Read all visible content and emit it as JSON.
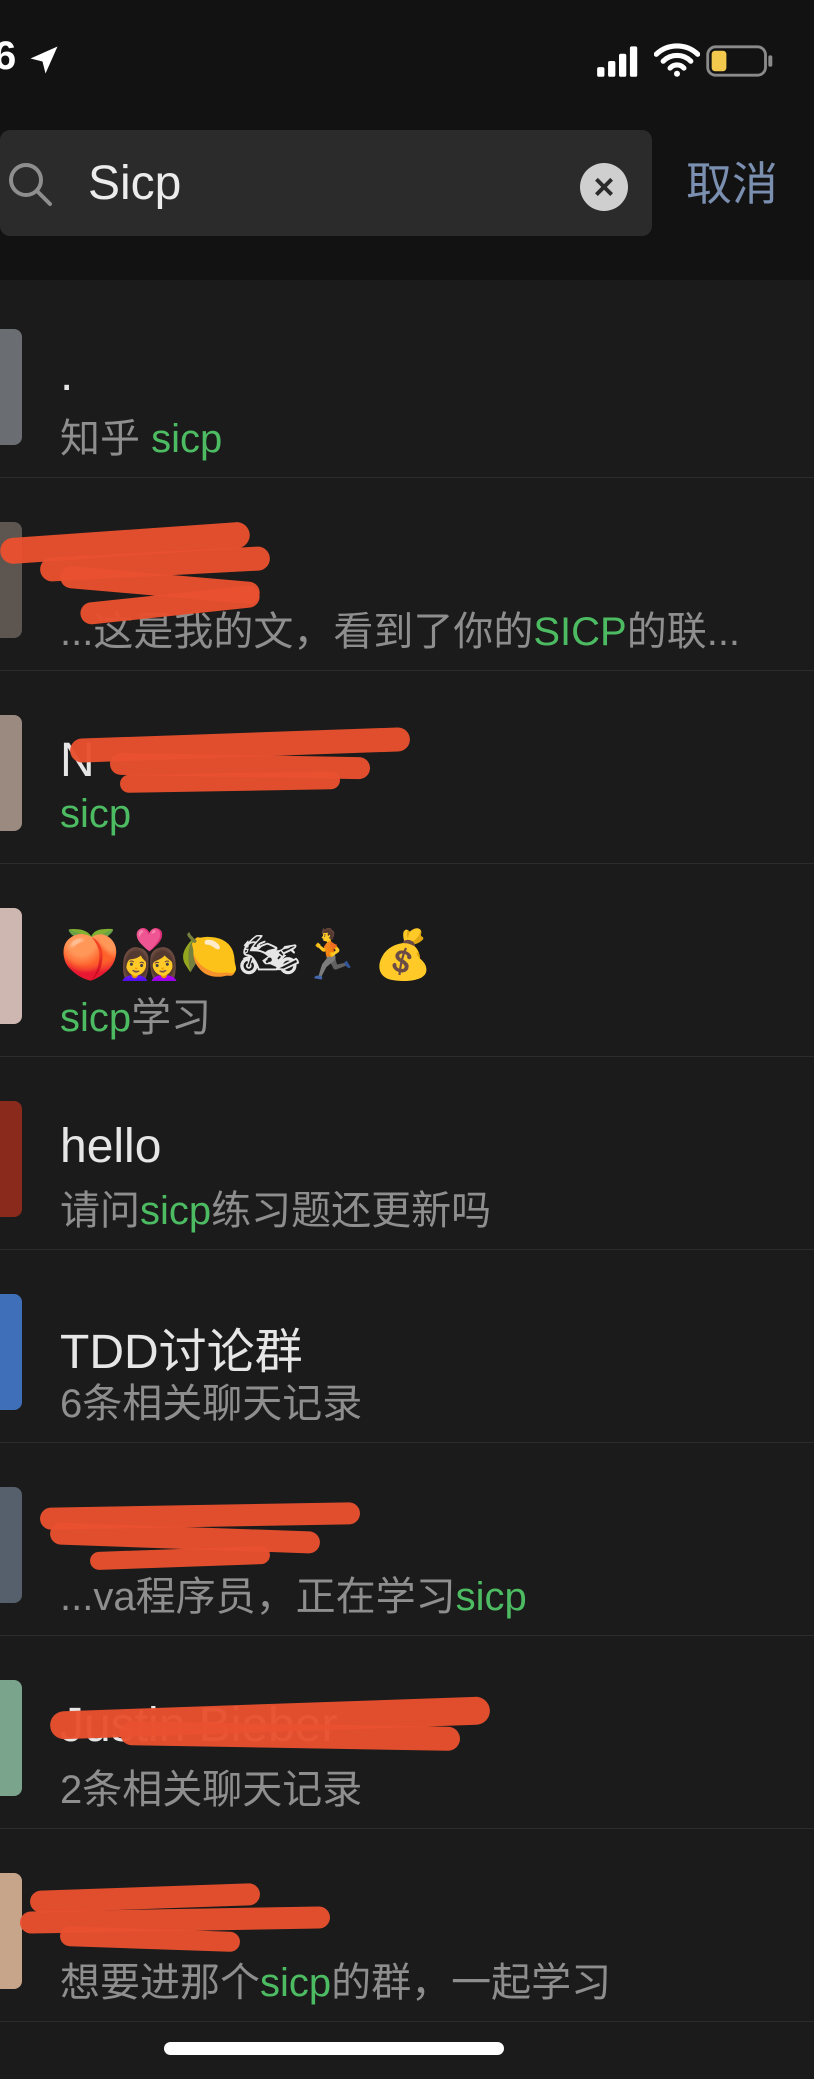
{
  "status_bar": {
    "time": "6",
    "icons": [
      "location-arrow-icon",
      "cellular-signal-icon",
      "wifi-icon",
      "battery-low-icon"
    ],
    "battery_color": "#f2c94c"
  },
  "search": {
    "query": "Sicp",
    "cancel_label": "取消",
    "clear_icon": "×"
  },
  "colors": {
    "background": "#1b1b1b",
    "header": "#121212",
    "highlight": "#4cbb62",
    "cancel": "#7b8fb0",
    "redaction": "#e8512f"
  },
  "results": [
    {
      "title": ".",
      "sub": [
        {
          "text": "知乎 "
        },
        {
          "text": "sicp",
          "hl": true
        }
      ],
      "avatar": "#6a6e73"
    },
    {
      "title": "",
      "redacted_title": true,
      "sub": [
        {
          "text": "...这是我的文，看到了你的"
        },
        {
          "text": "SICP",
          "hl": true
        },
        {
          "text": "的联..."
        }
      ],
      "avatar": "#5d5550"
    },
    {
      "title": "N",
      "redacted_title": true,
      "sub": [
        {
          "text": "sicp",
          "hl": true
        }
      ],
      "avatar": "#9a8a80"
    },
    {
      "title": "🍑👩‍❤️‍👩🍋🏍🏃 💰",
      "sub": [
        {
          "text": "sicp",
          "hl": true
        },
        {
          "text": "学习"
        }
      ],
      "avatar": "#cdb7b0"
    },
    {
      "title": "hello",
      "sub": [
        {
          "text": "请问"
        },
        {
          "text": "sicp",
          "hl": true
        },
        {
          "text": "练习题还更新吗"
        }
      ],
      "avatar": "#8a2a1c"
    },
    {
      "title": "TDD讨论群",
      "sub": [
        {
          "text": "6条相关聊天记录"
        }
      ],
      "avatar": "#3f6fb8"
    },
    {
      "title": "",
      "redacted_title": true,
      "sub": [
        {
          "text": "...va程序员，正在学习"
        },
        {
          "text": "sicp",
          "hl": true
        }
      ],
      "avatar": "#56606c"
    },
    {
      "title": "Justin Bieber",
      "redacted_title": true,
      "sub": [
        {
          "text": "2条相关聊天记录"
        }
      ],
      "avatar": "#7aa48c"
    },
    {
      "title": "",
      "redacted_title": true,
      "sub": [
        {
          "text": "想要进那个"
        },
        {
          "text": "sicp",
          "hl": true
        },
        {
          "text": "的群，一起学习"
        }
      ],
      "avatar": "#c7a58a"
    }
  ]
}
